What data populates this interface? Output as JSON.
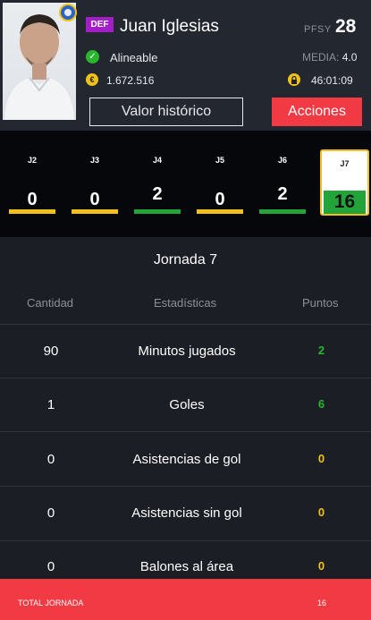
{
  "player": {
    "position": "DEF",
    "name": "Juan Iglesias",
    "pfsy_label": "PFSY",
    "pfsy_value": "28",
    "status": "Alineable",
    "media_label": "MEDIA:",
    "media_value": "4.0",
    "price": "1.672.516",
    "timer": "46:01:09",
    "coin_symbol": "€"
  },
  "buttons": {
    "historic": "Valor histórico",
    "actions": "Acciones"
  },
  "rounds": [
    {
      "label": "J2",
      "value": "0",
      "bar_color": "#f0c11b"
    },
    {
      "label": "J3",
      "value": "0",
      "bar_color": "#f0c11b"
    },
    {
      "label": "J4",
      "value": "2",
      "bar_color": "#23a43a"
    },
    {
      "label": "J5",
      "value": "0",
      "bar_color": "#f0c11b"
    },
    {
      "label": "J6",
      "value": "2",
      "bar_color": "#23a43a"
    }
  ],
  "active_round": {
    "label": "J7",
    "value": "16"
  },
  "detail": {
    "title": "Jornada 7",
    "col_quantity": "Cantidad",
    "col_stats": "Estadísticas",
    "col_points": "Puntos",
    "rows": [
      {
        "qty": "90",
        "name": "Minutos jugados",
        "pts": "2",
        "pts_color": "#2ab52e"
      },
      {
        "qty": "1",
        "name": "Goles",
        "pts": "6",
        "pts_color": "#2ab52e"
      },
      {
        "qty": "0",
        "name": "Asistencias de gol",
        "pts": "0",
        "pts_color": "#f0c11b"
      },
      {
        "qty": "0",
        "name": "Asistencias sin gol",
        "pts": "0",
        "pts_color": "#f0c11b"
      },
      {
        "qty": "0",
        "name": "Balones al área",
        "pts": "0",
        "pts_color": "#f0c11b"
      }
    ]
  },
  "total": {
    "label": "TOTAL JORNADA",
    "value": "16"
  },
  "colors": {
    "accent_red": "#f23a45",
    "positive_green": "#23a43a",
    "neutral_yellow": "#f0c11b",
    "position_purple": "#a21fc7"
  }
}
